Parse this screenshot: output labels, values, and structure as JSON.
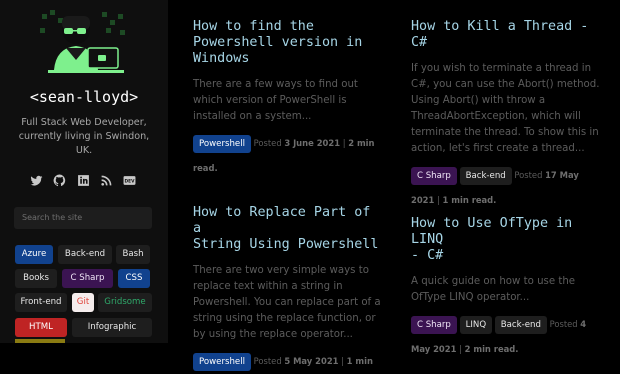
{
  "sidebar": {
    "handle": "<sean-lloyd>",
    "bio": "Full Stack Web Developer, currently living in Swindon, UK.",
    "socials": [
      {
        "icon": "twitter-icon"
      },
      {
        "icon": "github-icon"
      },
      {
        "icon": "linkedin-icon"
      },
      {
        "icon": "rss-icon"
      },
      {
        "icon": "dev-icon",
        "label": "DEV"
      }
    ],
    "search_placeholder": "Search the site",
    "tags": [
      "Azure",
      "Back-end",
      "Bash",
      "Books",
      "C Sharp",
      "CSS",
      "Front-end",
      "Git",
      "Gridsome",
      "HTML",
      "Infographic"
    ]
  },
  "posts": [
    {
      "title": "How to find the\nPowershell version in\nWindows",
      "excerpt": "There are a few ways to find out which version of PowerShell is installed on a system...",
      "tags": [
        "Powershell"
      ],
      "posted": "Posted",
      "date": "3 June 2021",
      "sep": "|",
      "read": "2 min read."
    },
    {
      "title": "How to Kill a Thread - C#",
      "excerpt": "If you wish to terminate a thread in C#, you can use the Abort() method. Using Abort() with throw a ThreadAbortException, which will terminate the thread. To show this in action, let's first create a thread...",
      "tags": [
        "C Sharp",
        "Back-end"
      ],
      "posted": "Posted",
      "date": "17 May 2021",
      "sep": "|",
      "read": "1 min read."
    },
    {
      "title": "How to Replace Part of a\nString Using Powershell",
      "excerpt": "There are two very simple ways to replace text within a string in Powershell. You can replace part of a string using the replace function, or by using the replace operator...",
      "tags": [
        "Powershell"
      ],
      "posted": "Posted",
      "date": "5 May 2021",
      "sep": "|",
      "read": "1 min"
    },
    {
      "title": "How to Use OfType in LINQ\n- C#",
      "excerpt": "A quick guide on how to use the OfType LINQ operator...",
      "tags": [
        "C Sharp",
        "LINQ",
        "Back-end"
      ],
      "posted": "Posted",
      "date": "4 May 2021",
      "sep": "|",
      "read": "2 min read."
    }
  ],
  "colors": {
    "accent_title": "#a6d5e6",
    "tag_blue": "#11428e",
    "tag_purple": "#3b1452",
    "tag_red": "#bf2424",
    "tag_green_text": "#2fa96a",
    "avatar_green": "#7ef08d"
  }
}
